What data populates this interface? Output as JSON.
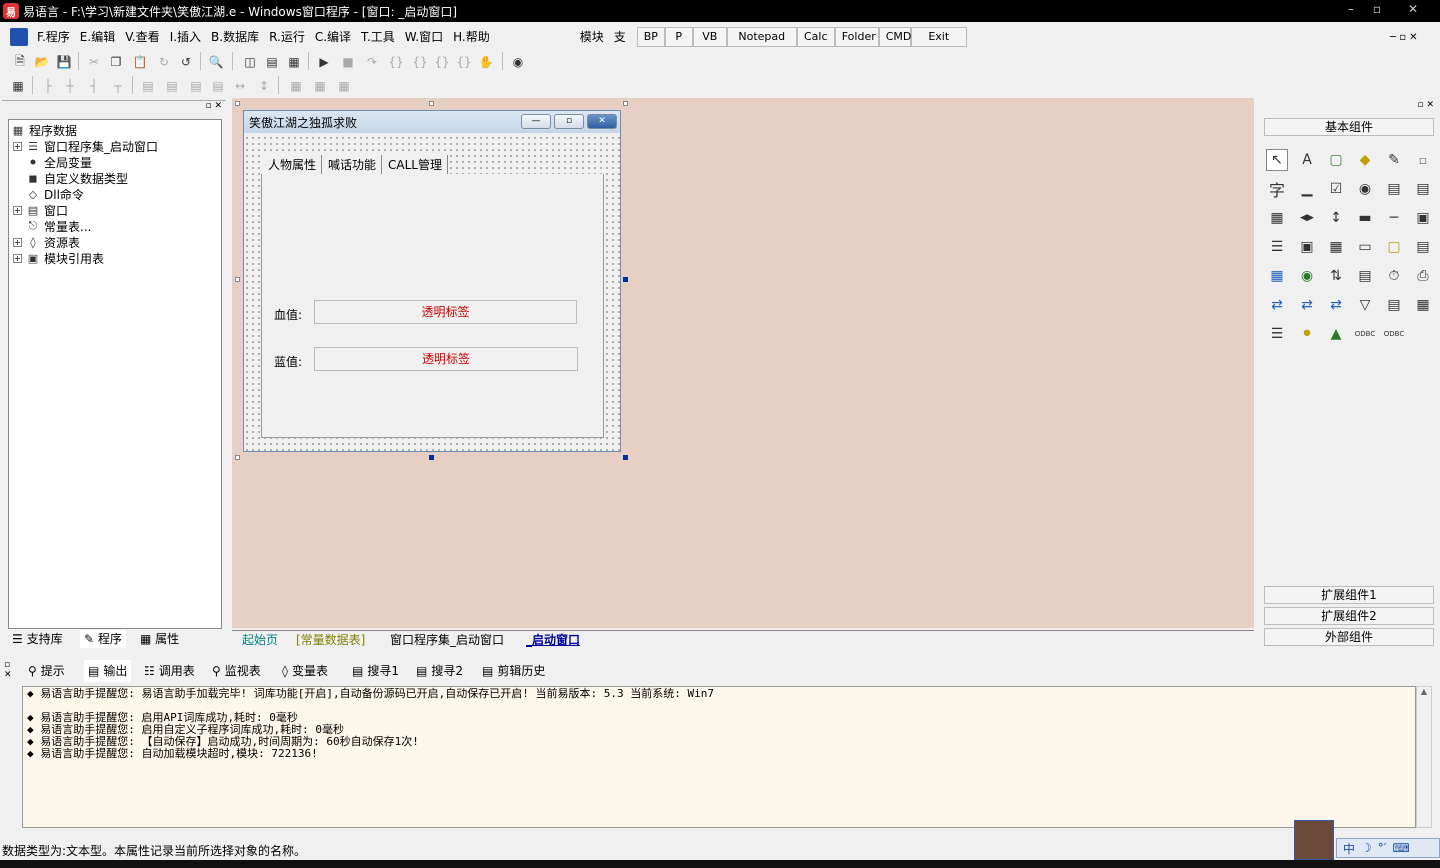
{
  "window": {
    "title": "易语言 - F:\\学习\\新建文件夹\\笑傲江湖.e - Windows窗口程序 - [窗口: _启动窗口]"
  },
  "menu": [
    {
      "label": "F.程序"
    },
    {
      "label": "E.编辑"
    },
    {
      "label": "V.查看"
    },
    {
      "label": "I.插入"
    },
    {
      "label": "B.数据库"
    },
    {
      "label": "R.运行"
    },
    {
      "label": "C.编译"
    },
    {
      "label": "T.工具"
    },
    {
      "label": "W.窗口"
    },
    {
      "label": "H.帮助"
    }
  ],
  "menu_extra": {
    "module": "模块",
    "support": "支持"
  },
  "quick_buttons": [
    "BP",
    "P",
    "VB",
    "Notepad",
    "Calc",
    "Folder",
    "CMD",
    "Exit"
  ],
  "tree": {
    "root": "程序数据",
    "items": [
      "窗口程序集_启动窗口",
      "全局变量",
      "自定义数据类型",
      "Dll命令",
      "窗口",
      "常量表...",
      "资源表",
      "模块引用表"
    ]
  },
  "left_tabs": [
    "支持库",
    "程序",
    "属性"
  ],
  "form": {
    "title": "笑傲江湖之独孤求败",
    "tabs": [
      "人物属性",
      "喊话功能",
      "CALL管理"
    ],
    "hp_label": "血值:",
    "mp_label": "蓝值:",
    "hp_value": "透明标签",
    "mp_value": "透明标签"
  },
  "editor_tabs": [
    "起始页",
    "[常量数据表]",
    "窗口程序集_启动窗口",
    "_启动窗口"
  ],
  "right_panel": {
    "header": "基本组件",
    "text_icon": "字",
    "extra": [
      "扩展组件1",
      "扩展组件2",
      "外部组件"
    ]
  },
  "output_tabs": [
    "提示",
    "输出",
    "调用表",
    "监视表",
    "变量表",
    "搜寻1",
    "搜寻2",
    "剪辑历史"
  ],
  "output_lines": [
    "◆ 易语言助手提醒您: 易语言助手加载完毕! 词库功能[开启],自动备份源码已开启,自动保存已开启! 当前易版本: 5.3 当前系统: Win7",
    "",
    "◆ 易语言助手提醒您: 启用API词库成功,耗时: 0毫秒",
    "◆ 易语言助手提醒您: 启用自定义子程序词库成功,耗时: 0毫秒",
    "◆ 易语言助手提醒您: 【自动保存】启动成功,时间周期为: 60秒自动保存1次!",
    "◆ 易语言助手提醒您: 自动加载模块超时,模块: 722136!"
  ],
  "status": "数据类型为:文本型。本属性记录当前所选择对象的名称。",
  "ime": {
    "label": "中"
  },
  "colors": {
    "design_bg": "#e8cfc4",
    "output_bg": "#fdf6ea",
    "label_red": "#cc0000",
    "active_tab": "#0000a0"
  }
}
